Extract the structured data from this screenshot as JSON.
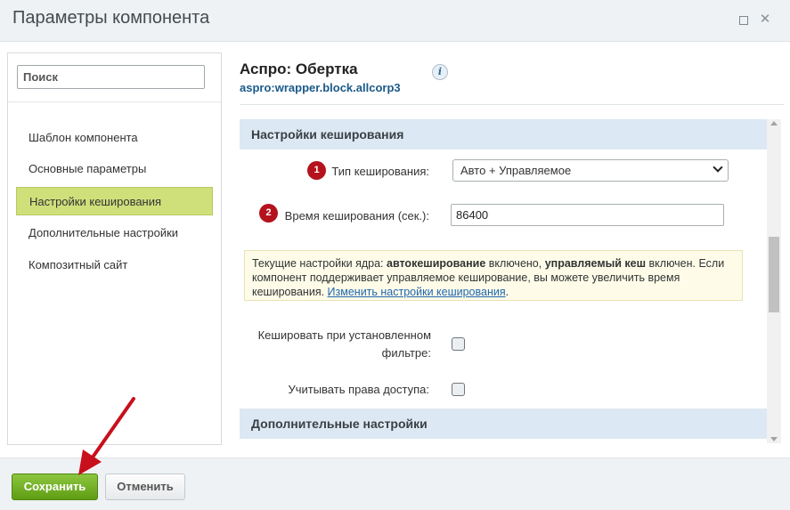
{
  "window": {
    "title": "Параметры компонента",
    "maximize_icon": "maximize-icon",
    "close_icon": "close-icon",
    "close_glyph": "✕"
  },
  "sidebar": {
    "search_placeholder": "Поиск",
    "items": [
      {
        "label": "Шаблон компонента",
        "active": false
      },
      {
        "label": "Основные параметры",
        "active": false
      },
      {
        "label": "Настройки кеширования",
        "active": true
      },
      {
        "label": "Дополнительные настройки",
        "active": false
      },
      {
        "label": "Композитный сайт",
        "active": false
      }
    ]
  },
  "component": {
    "title": "Аспро: Обертка",
    "id": "aspro:wrapper.block.allcorp3",
    "info_glyph": "i"
  },
  "caching_section": {
    "header": "Настройки кеширования",
    "cache_type": {
      "marker": "1",
      "label": "Тип кеширования:",
      "value": "Авто + Управляемое"
    },
    "cache_time": {
      "marker": "2",
      "label": "Время кеширования (сек.):",
      "value": "86400"
    },
    "note": {
      "t1": "Текущие настройки ядра: ",
      "b1": "автокеширование",
      "t2": " включено, ",
      "b2": "управляемый кеш",
      "t3": " включен. Если компонент поддерживает управляемое кеширование, вы можете увеличить время кеширования. ",
      "link": "Изменить настройки кеширования",
      "t4": "."
    },
    "cache_filter": {
      "label_line1": "Кешировать при установленном",
      "label_line2": "фильтре:",
      "checked": false
    },
    "access_rights": {
      "label": "Учитывать права доступа:",
      "checked": false
    }
  },
  "additional_section": {
    "header": "Дополнительные настройки"
  },
  "footer": {
    "save_label": "Сохранить",
    "cancel_label": "Отменить"
  },
  "colors": {
    "accent_green": "#7cb82f",
    "active_nav": "#cfe07b",
    "marker_red": "#b4121d",
    "section_blue": "#dce8f3",
    "arrow_red": "#c8101c"
  }
}
